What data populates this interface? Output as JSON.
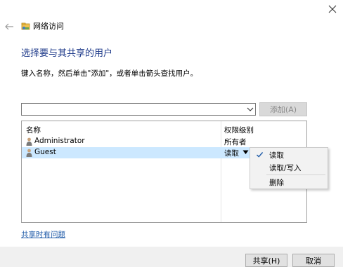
{
  "window": {
    "title": "网络访问",
    "close_glyph": "✕"
  },
  "heading": "选择要与其共享的用户",
  "instructions": "键入名称，然后单击\"添加\"，或者单击箭头查找用户。",
  "user_input": {
    "value": "",
    "placeholder": ""
  },
  "add_button": {
    "label": "添加(A)",
    "enabled": false
  },
  "user_list": {
    "columns": [
      "名称",
      "权限级别"
    ],
    "rows": [
      {
        "name": "Administrator",
        "permission": "所有者",
        "selected": false
      },
      {
        "name": "Guest",
        "permission": "读取",
        "selected": true
      }
    ]
  },
  "permission_menu": {
    "items": [
      {
        "label": "读取",
        "checked": true
      },
      {
        "label": "读取/写入",
        "checked": false
      },
      {
        "label": "删除",
        "checked": false
      }
    ]
  },
  "help_link": "共享时有问题",
  "footer": {
    "share_label": "共享(H)",
    "cancel_label": "取消"
  },
  "colors": {
    "heading": "#1e3a8a",
    "selection": "#cce8ff",
    "link": "#1e5aa8",
    "check": "#1e5aa8"
  },
  "icons": [
    "back-arrow-icon",
    "network-share-icon",
    "user-icon",
    "chevron-down-icon",
    "check-icon",
    "close-icon"
  ]
}
